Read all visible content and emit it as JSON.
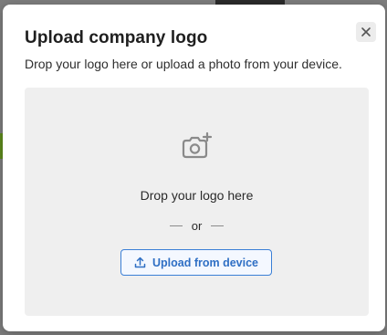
{
  "modal": {
    "title": "Upload company logo",
    "subtitle": "Drop your logo here or upload a photo from your device.",
    "close_icon": "close-icon"
  },
  "dropzone": {
    "icon": "camera-plus-icon",
    "drop_text": "Drop your logo here",
    "or_text": "or",
    "upload_button_label": "Upload from device",
    "upload_icon": "upload-icon"
  },
  "colors": {
    "accent": "#3a7fd6",
    "dropzone_bg": "#efefef"
  }
}
